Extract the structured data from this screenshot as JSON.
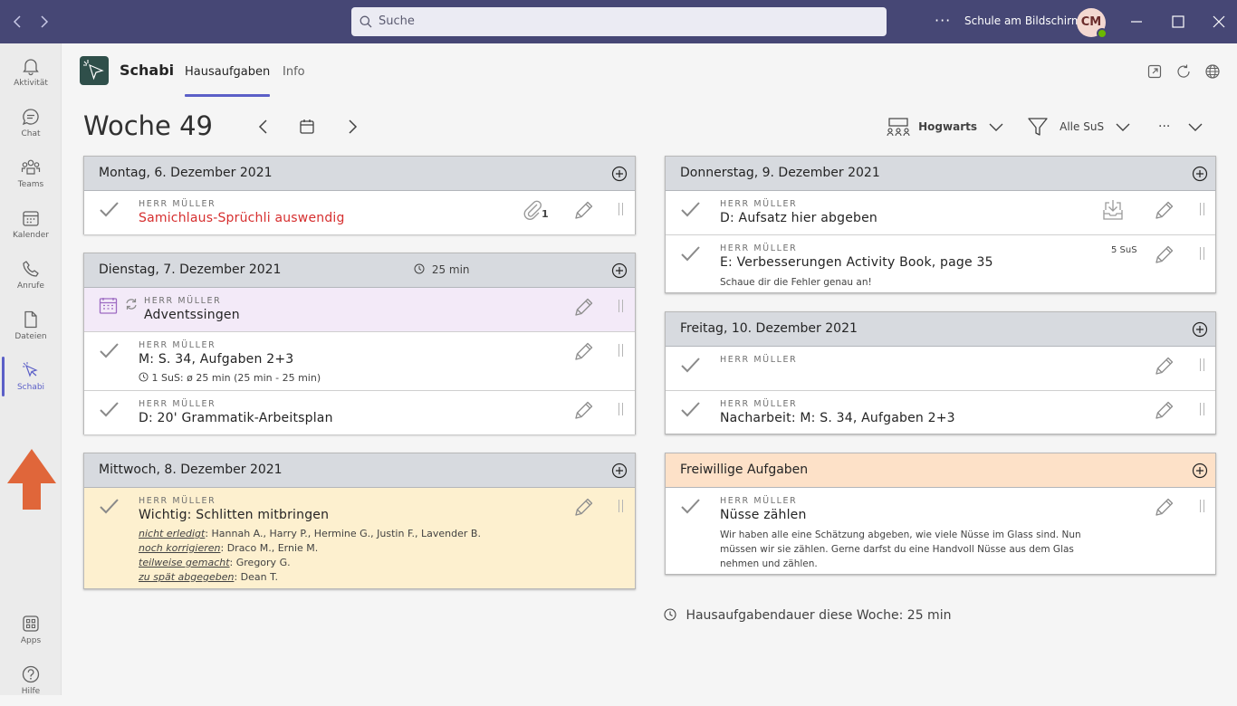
{
  "window": {
    "search_placeholder": "Suche",
    "user_name": "Schule am Bildschirm",
    "avatar_initials": "CM",
    "more": "···"
  },
  "rail": [
    {
      "label": "Aktivität",
      "icon": "bell-icon"
    },
    {
      "label": "Chat",
      "icon": "chat-icon"
    },
    {
      "label": "Teams",
      "icon": "teams-icon"
    },
    {
      "label": "Kalender",
      "icon": "calendar-icon"
    },
    {
      "label": "Anrufe",
      "icon": "phone-icon"
    },
    {
      "label": "Dateien",
      "icon": "file-icon"
    },
    {
      "label": "Schabi",
      "icon": "schabi-icon"
    },
    {
      "label": "Apps",
      "icon": "apps-icon"
    },
    {
      "label": "Hilfe",
      "icon": "help-icon"
    }
  ],
  "app": {
    "name": "Schabi",
    "tabs": [
      "Hausaufgaben",
      "Info"
    ]
  },
  "week": {
    "title": "Woche 49",
    "class_filter": "Hogwarts",
    "student_filter": "Alle SuS",
    "more": "···",
    "total": "Hausaufgabendauer diese Woche: 25 min"
  },
  "days": {
    "mon": {
      "title": "Montag, 6. Dezember 2021",
      "tasks": [
        {
          "teacher": "HERR MÜLLER",
          "title": "Samichlaus-Sprüchli auswendig",
          "attachments": "1"
        }
      ]
    },
    "tue": {
      "title": "Dienstag, 7. Dezember 2021",
      "duration": "25 min",
      "tasks": [
        {
          "teacher": "HERR MÜLLER",
          "title": "Adventssingen"
        },
        {
          "teacher": "HERR MÜLLER",
          "title": "M: S. 34, Aufgaben 2+3",
          "stat": "1 SuS: ø 25 min (25 min - 25 min)"
        },
        {
          "teacher": "HERR MÜLLER",
          "title": "D: 20' Grammatik-Arbeitsplan"
        }
      ]
    },
    "wed": {
      "title": "Mittwoch, 8. Dezember 2021",
      "tasks": [
        {
          "teacher": "HERR MÜLLER",
          "title": "Wichtig: Schlitten mitbringen",
          "status": [
            {
              "label": "nicht erledigt",
              "names": ": Hannah A., Harry P., Hermine G., Justin F., Lavender B."
            },
            {
              "label": "noch korrigieren",
              "names": ": Draco M., Ernie M."
            },
            {
              "label": "teilweise gemacht",
              "names": ": Gregory G."
            },
            {
              "label": "zu spät abgegeben",
              "names": ": Dean T."
            }
          ]
        }
      ]
    },
    "thu": {
      "title": "Donnerstag, 9. Dezember 2021",
      "tasks": [
        {
          "teacher": "HERR MÜLLER",
          "title": "D: Aufsatz hier abgeben"
        },
        {
          "teacher": "HERR MÜLLER",
          "title": "E: Verbesserungen Activity Book, page 35",
          "count": "5 SuS",
          "note": "Schaue dir die Fehler genau an!"
        }
      ]
    },
    "fri": {
      "title": "Freitag, 10. Dezember 2021",
      "tasks": [
        {
          "teacher": "HERR MÜLLER",
          "title": ""
        },
        {
          "teacher": "HERR MÜLLER",
          "title": "Nacharbeit: M: S. 34, Aufgaben 2+3"
        }
      ]
    },
    "opt": {
      "title": "Freiwillige Aufgaben",
      "tasks": [
        {
          "teacher": "HERR MÜLLER",
          "title": "Nüsse zählen",
          "desc": "Wir haben alle eine Schätzung abgeben, wie viele Nüsse im Glass sind. Nun müssen wir sie zählen. Gerne darfst du eine Handvoll Nüsse aus dem Glas nehmen und zählen."
        }
      ]
    }
  },
  "colors": {
    "titlebar": "#464775",
    "accent": "#5b5fc7",
    "overdue": "#d62f2f",
    "day_header": "#d7dadf",
    "optional_header": "#fde1c8",
    "event_bg": "#f3eaf8",
    "important_bg": "#fdf0cf",
    "arrow": "#e0663a"
  }
}
